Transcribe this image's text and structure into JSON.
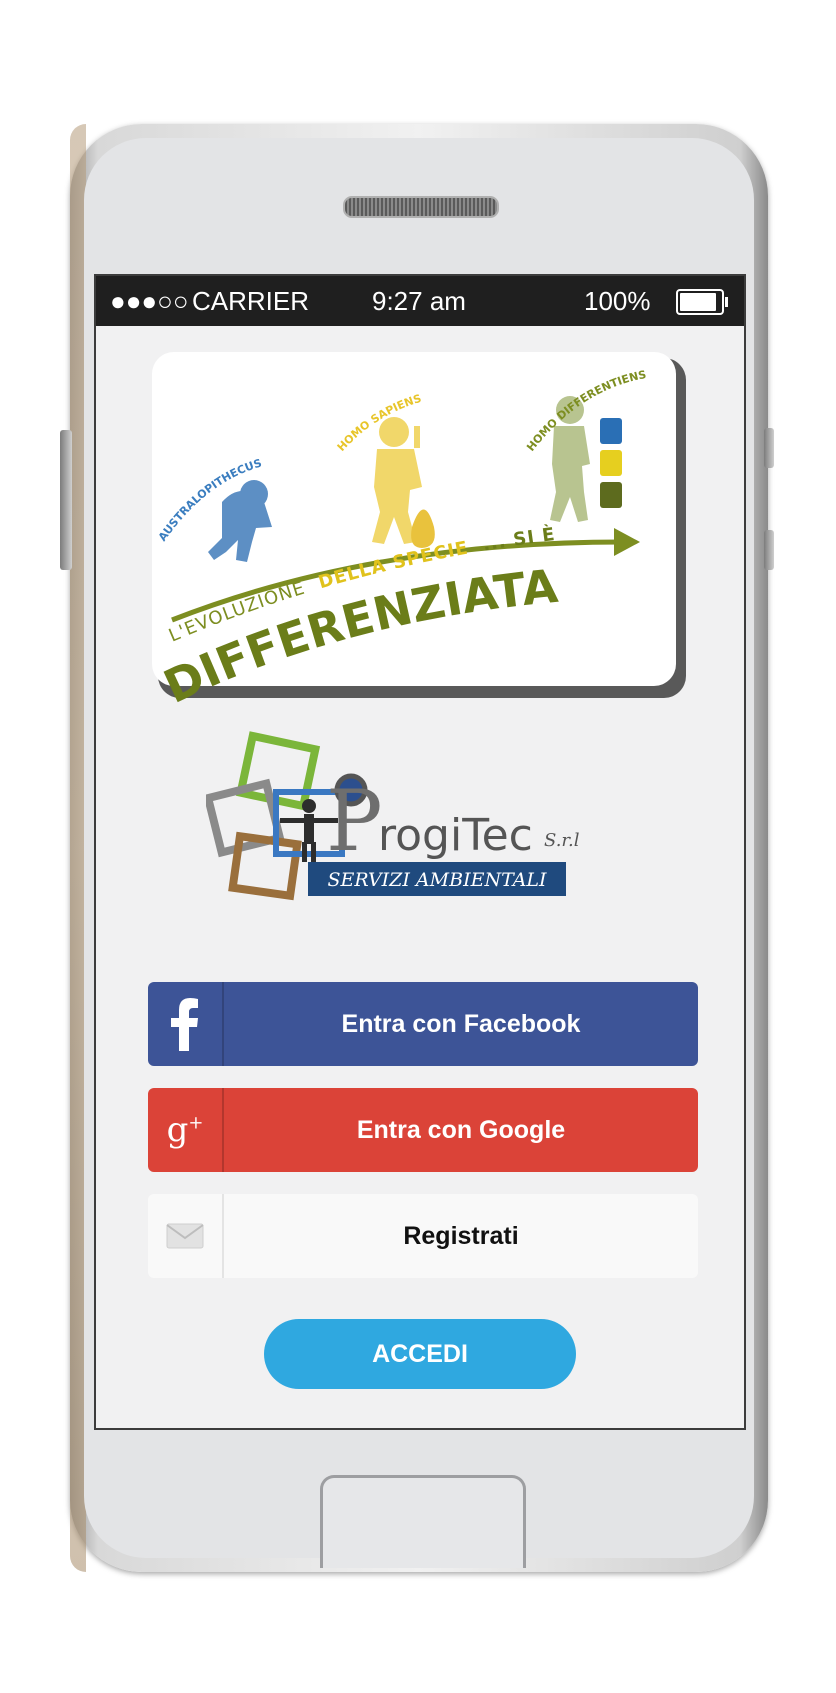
{
  "status_bar": {
    "signal": "●●●○○",
    "carrier": "CARRIER",
    "time": "9:27 am",
    "battery_pct": "100%",
    "battery_level": 1.0
  },
  "banner": {
    "stage1": "AUSTRALOPITHECUS",
    "stage2": "HOMO SAPIENS",
    "stage3": "HOMO DIFFERENTIENS",
    "line1_a": "L'EVOLUZIONE",
    "line1_b": "DELLA SPECIE",
    "line1_c": "... SI È",
    "line2": "DIFFERENZIATA"
  },
  "company_logo": {
    "name_p": "P",
    "name": "rogiTec",
    "suffix": "S.r.l",
    "tagline": "SERVIZI AMBIENTALI"
  },
  "buttons": {
    "facebook": "Entra con Facebook",
    "google": "Entra con Google",
    "register": "Registrati",
    "login": "ACCEDI"
  },
  "colors": {
    "facebook": "#3d5497",
    "google": "#db4338",
    "login": "#2fa8e0",
    "banner_green": "#6b7d19"
  }
}
